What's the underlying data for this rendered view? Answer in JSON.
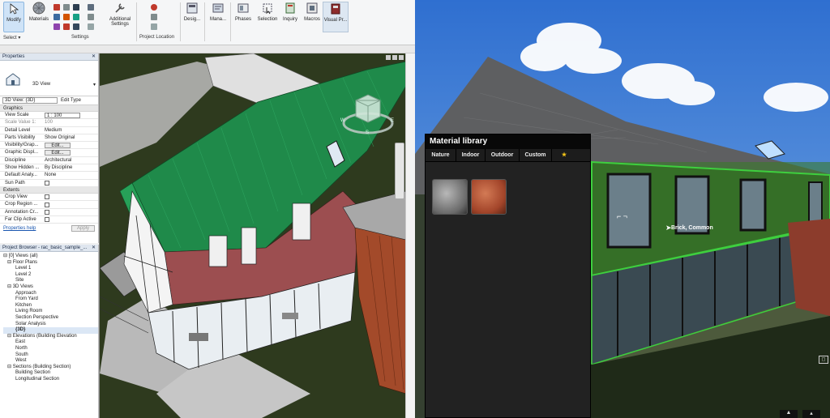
{
  "ribbon": {
    "buttons": [
      {
        "label": "Modify",
        "icon": "cursor-icon"
      },
      {
        "label": "Materials",
        "icon": "materials-sphere-icon"
      },
      {
        "label": "Additional\nSettings",
        "icon": "wrench-icon"
      },
      {
        "label": "Desig...",
        "icon": "design-options-icon"
      },
      {
        "label": "Mana...",
        "icon": "manage-icon"
      },
      {
        "label": "Phases",
        "icon": "phases-icon"
      },
      {
        "label": "Selection",
        "icon": "selection-icon"
      },
      {
        "label": "Inquiry",
        "icon": "inquiry-icon"
      },
      {
        "label": "Macros",
        "icon": "macros-icon"
      },
      {
        "label": "Visual Pr...",
        "icon": "visual-programming-icon"
      }
    ],
    "groups": [
      "Select ▾",
      "Settings",
      "Project Location"
    ]
  },
  "properties": {
    "title": "Properties",
    "type_name": "3D View",
    "selector": "3D View: {3D}",
    "edit_type": "Edit Type",
    "sections": {
      "graphics": "Graphics",
      "extents": "Extents"
    },
    "rows": [
      {
        "k": "View Scale",
        "v": "1 : 100"
      },
      {
        "k": "Scale Value   1:",
        "v": "100"
      },
      {
        "k": "Detail Level",
        "v": "Medium"
      },
      {
        "k": "Parts Visibility",
        "v": "Show Original"
      },
      {
        "k": "Visibility/Grap...",
        "v": "Edit..."
      },
      {
        "k": "Graphic Displ...",
        "v": "Edit..."
      },
      {
        "k": "Discipline",
        "v": "Architectural"
      },
      {
        "k": "Show Hidden ...",
        "v": "By Discipline"
      },
      {
        "k": "Default Analy...",
        "v": "None"
      },
      {
        "k": "Sun Path",
        "v": ""
      }
    ],
    "extent_rows": [
      {
        "k": "Crop View"
      },
      {
        "k": "Crop Region ..."
      },
      {
        "k": "Annotation Cr..."
      },
      {
        "k": "Far Clip Active"
      }
    ],
    "help_link": "Properties help",
    "apply": "Apply"
  },
  "browser": {
    "title": "Project Browser - rac_basic_sample_...",
    "items": [
      {
        "t": "⊟ [0] Views (all)",
        "d": 0
      },
      {
        "t": "⊟ Floor Plans",
        "d": 1
      },
      {
        "t": "Level 1",
        "d": 3
      },
      {
        "t": "Level 2",
        "d": 3
      },
      {
        "t": "Site",
        "d": 3
      },
      {
        "t": "⊟ 3D Views",
        "d": 1
      },
      {
        "t": "Approach",
        "d": 3
      },
      {
        "t": "From Yard",
        "d": 3
      },
      {
        "t": "Kitchen",
        "d": 3
      },
      {
        "t": "Living Room",
        "d": 3
      },
      {
        "t": "Section Perspective",
        "d": 3
      },
      {
        "t": "Solar Analysis",
        "d": 3
      },
      {
        "t": "{3D}",
        "d": 3,
        "bold": true
      },
      {
        "t": "⊟ Elevations (Building Elevation",
        "d": 1
      },
      {
        "t": "East",
        "d": 3
      },
      {
        "t": "North",
        "d": 3
      },
      {
        "t": "South",
        "d": 3
      },
      {
        "t": "West",
        "d": 3
      },
      {
        "t": "⊟ Sections (Building Section)",
        "d": 1
      },
      {
        "t": "Building Section",
        "d": 3
      },
      {
        "t": "Longitudinal Section",
        "d": 3
      }
    ]
  },
  "viewcube": {
    "labels": [
      "W",
      "S",
      "E"
    ]
  },
  "material_library": {
    "title": "Material library",
    "tabs": [
      "Nature",
      "Indoor",
      "Outdoor",
      "Custom"
    ],
    "star": "★"
  },
  "render_view": {
    "material_label": "Brick, Common"
  },
  "colors": {
    "roof_green": "#1f8a4a",
    "wall_red": "#9c4e50",
    "grass": "#2e3a1e",
    "highlight_green": "#3ecf3e"
  }
}
